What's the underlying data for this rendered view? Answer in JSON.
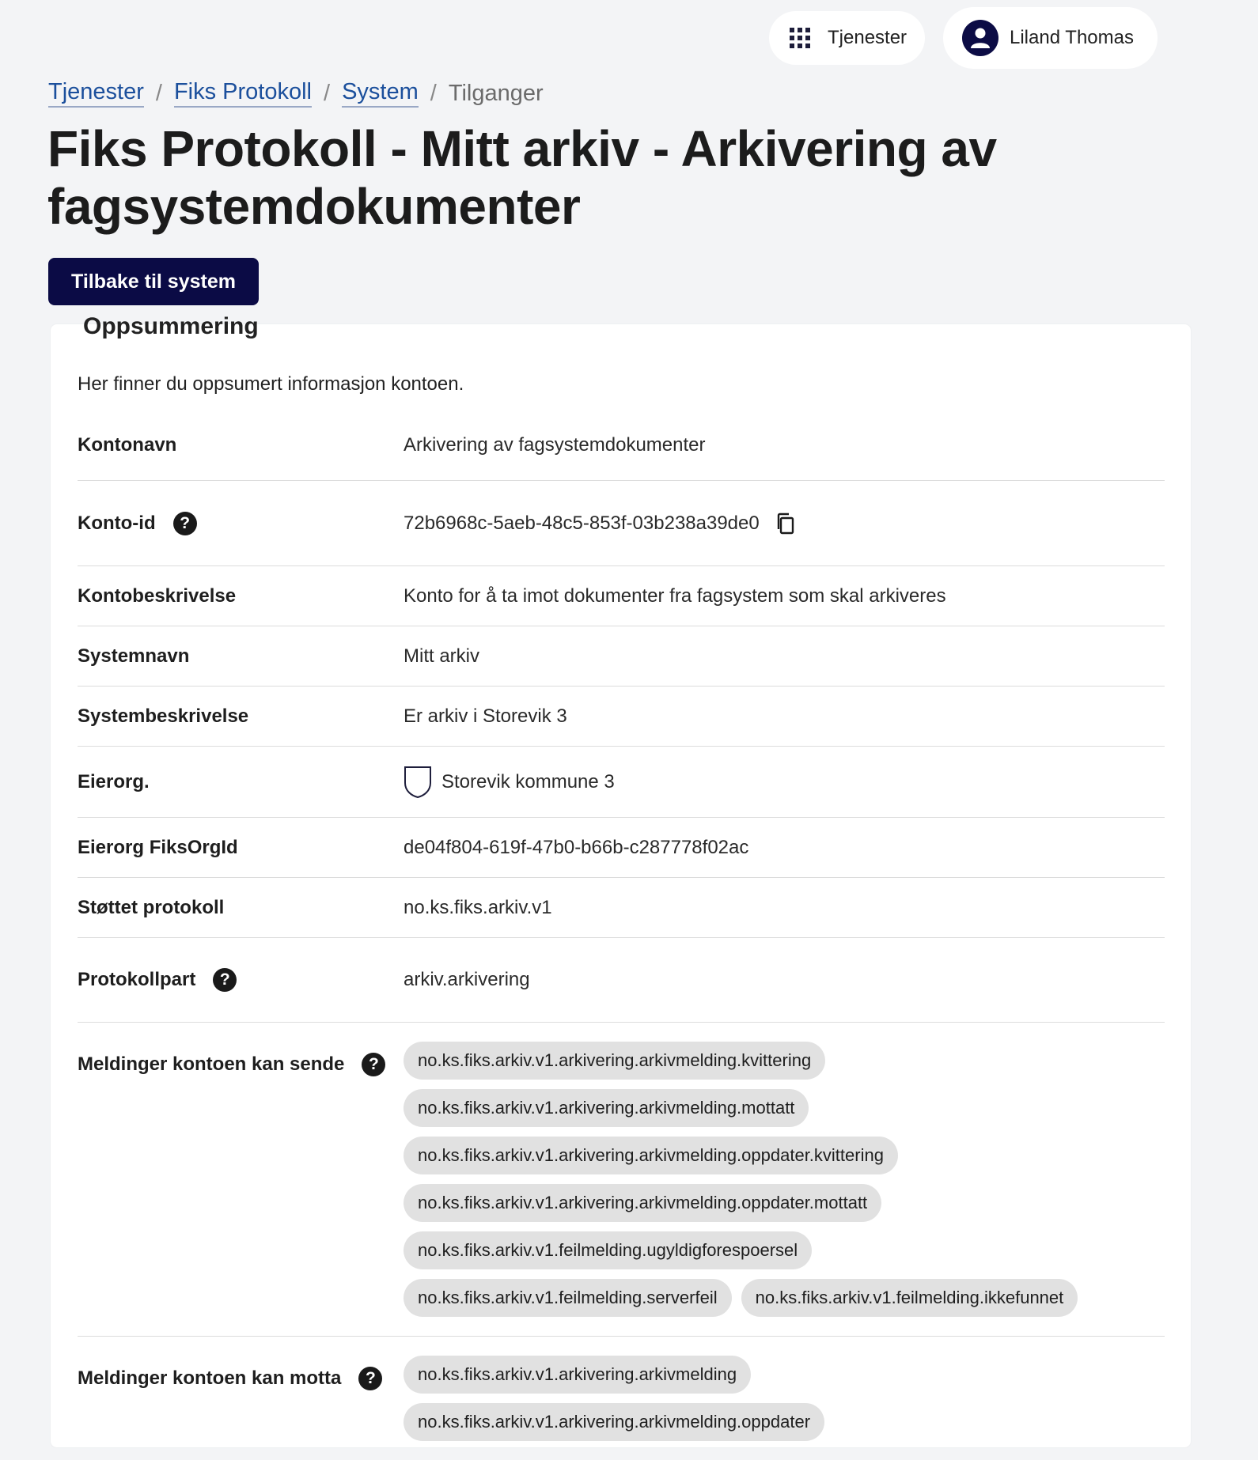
{
  "header": {
    "services_label": "Tjenester",
    "user_name": "Liland Thomas"
  },
  "breadcrumb": {
    "items": [
      "Tjenester",
      "Fiks Protokoll",
      "System"
    ],
    "current": "Tilganger"
  },
  "page": {
    "title": "Fiks Protokoll - Mitt arkiv - Arkivering av fagsystemdokumenter",
    "back_button": "Tilbake til system"
  },
  "summary": {
    "title": "Oppsummering",
    "intro": "Her finner du oppsumert informasjon kontoen.",
    "rows": {
      "kontonavn": {
        "label": "Kontonavn",
        "value": "Arkivering av fagsystemdokumenter"
      },
      "konto_id": {
        "label": "Konto-id",
        "value": "72b6968c-5aeb-48c5-853f-03b238a39de0"
      },
      "kontobeskrivelse": {
        "label": "Kontobeskrivelse",
        "value": "Konto for å ta imot dokumenter fra fagsystem som skal arkiveres"
      },
      "systemnavn": {
        "label": "Systemnavn",
        "value": "Mitt arkiv"
      },
      "systembeskrivelse": {
        "label": "Systembeskrivelse",
        "value": "Er arkiv i Storevik 3"
      },
      "eierorg": {
        "label": "Eierorg.",
        "value": "Storevik kommune 3"
      },
      "eierorg_fiksorgid": {
        "label": "Eierorg FiksOrgId",
        "value": "de04f804-619f-47b0-b66b-c287778f02ac"
      },
      "stottet_protokoll": {
        "label": "Støttet protokoll",
        "value": "no.ks.fiks.arkiv.v1"
      },
      "protokollpart": {
        "label": "Protokollpart",
        "value": "arkiv.arkivering"
      }
    },
    "send": {
      "label": "Meldinger kontoen kan sende",
      "messages": [
        "no.ks.fiks.arkiv.v1.arkivering.arkivmelding.kvittering",
        "no.ks.fiks.arkiv.v1.arkivering.arkivmelding.mottatt",
        "no.ks.fiks.arkiv.v1.arkivering.arkivmelding.oppdater.kvittering",
        "no.ks.fiks.arkiv.v1.arkivering.arkivmelding.oppdater.mottatt",
        "no.ks.fiks.arkiv.v1.feilmelding.ugyldigforespoersel",
        "no.ks.fiks.arkiv.v1.feilmelding.serverfeil",
        "no.ks.fiks.arkiv.v1.feilmelding.ikkefunnet"
      ]
    },
    "receive": {
      "label": "Meldinger kontoen kan motta",
      "messages": [
        "no.ks.fiks.arkiv.v1.arkivering.arkivmelding",
        "no.ks.fiks.arkiv.v1.arkivering.arkivmelding.oppdater"
      ]
    }
  },
  "colors": {
    "primary": "#0b0b45",
    "link": "#1b4f9c",
    "tag_bg": "#e1e1e1",
    "page_bg": "#f3f4f6"
  },
  "icons": [
    "grid-icon",
    "user-icon",
    "help-icon",
    "copy-icon",
    "shield-icon"
  ]
}
